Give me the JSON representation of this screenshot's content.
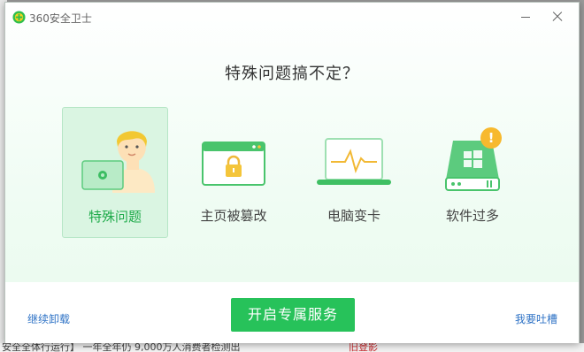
{
  "window": {
    "title": "360安全卫士"
  },
  "dialog": {
    "headline": "特殊问题搞不定？",
    "options": [
      {
        "label": "特殊问题",
        "icon": "user-with-laptop-icon",
        "selected": true
      },
      {
        "label": "主页被篡改",
        "icon": "locked-browser-icon",
        "selected": false
      },
      {
        "label": "电脑变卡",
        "icon": "laptop-performance-icon",
        "selected": false
      },
      {
        "label": "软件过多",
        "icon": "software-overload-icon",
        "badge": "!",
        "selected": false
      }
    ]
  },
  "footer": {
    "uninstall_label": "继续卸载",
    "cta_label": "开启专属服务",
    "feedback_label": "我要吐槽"
  },
  "background": {
    "fragment_text": "安全全体行运行】  一年全年仍 9,000万人消费者检测出",
    "fragment_red": "旧登影"
  },
  "colors": {
    "accent": "#27c25a",
    "link": "#2f73c6",
    "selected_bg": "#daf5e2"
  }
}
